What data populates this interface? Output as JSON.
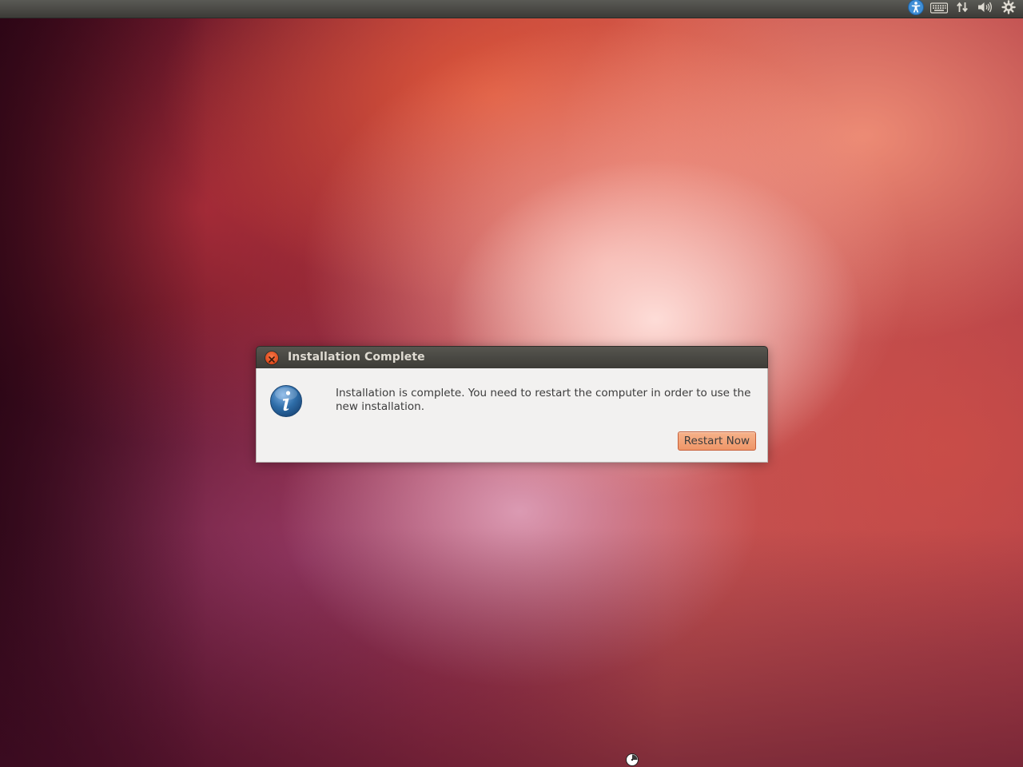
{
  "panel": {
    "indicators": [
      {
        "icon": "accessibility-icon"
      },
      {
        "icon": "keyboard-icon"
      },
      {
        "icon": "network-icon"
      },
      {
        "icon": "volume-icon"
      },
      {
        "icon": "session-gear-icon"
      }
    ]
  },
  "dialog": {
    "title": "Installation Complete",
    "message": "Installation is complete. You need to restart the computer in order to use the new installation.",
    "restart_label": "Restart Now",
    "icon": "info-icon",
    "close_icon": "close-icon"
  },
  "colors": {
    "accent": "#ee9668",
    "close_button": "#df4a1c",
    "panel": "#3c3b37",
    "dialog_bg": "#f2f1f0",
    "info_blue": "#2e6da8"
  }
}
